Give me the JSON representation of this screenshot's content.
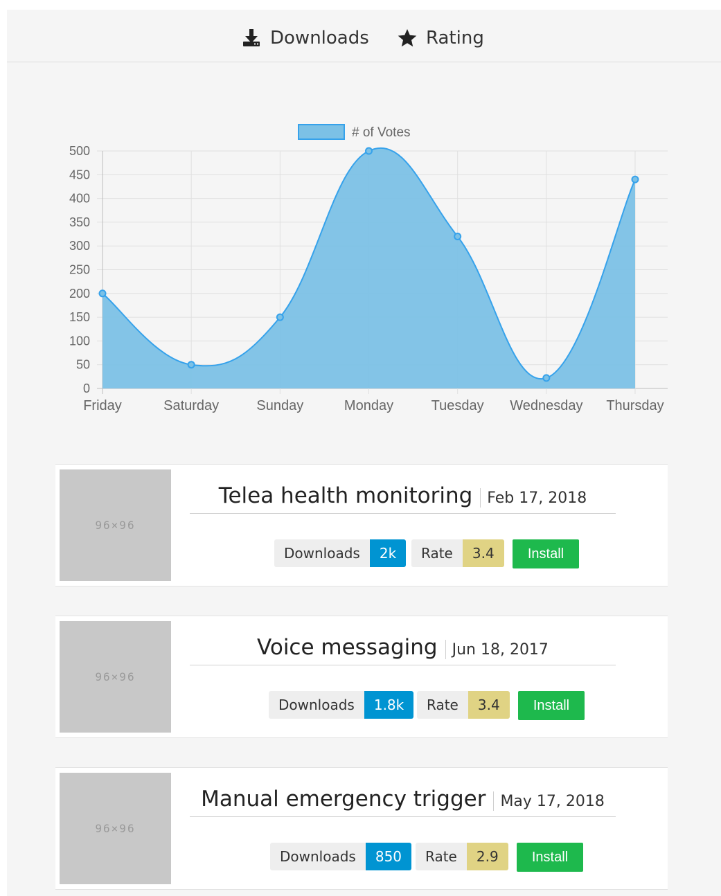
{
  "tabs": [
    {
      "label": "Downloads",
      "icon": "download-icon"
    },
    {
      "label": "Rating",
      "icon": "star-icon"
    }
  ],
  "chart_data": {
    "type": "line",
    "fill": "area",
    "categories": [
      "Friday",
      "Saturday",
      "Sunday",
      "Monday",
      "Tuesday",
      "Wednesday",
      "Thursday"
    ],
    "series": [
      {
        "name": "# of Votes",
        "values": [
          200,
          50,
          150,
          500,
          320,
          22,
          440
        ],
        "color": "#36a2eb",
        "fill_color": "#7cc1e6"
      }
    ],
    "ylim": [
      0,
      500
    ],
    "yticks": [
      0,
      50,
      100,
      150,
      200,
      250,
      300,
      350,
      400,
      450,
      500
    ],
    "grid": true,
    "legend": "top",
    "smooth": true
  },
  "apps": [
    {
      "thumb": "96×96",
      "title": "Telea health monitoring",
      "date": "Feb 17, 2018",
      "downloads_label": "Downloads",
      "downloads": "2k",
      "rate_label": "Rate",
      "rate": "3.4",
      "install": "Install"
    },
    {
      "thumb": "96×96",
      "title": "Voice messaging",
      "date": "Jun 18, 2017",
      "downloads_label": "Downloads",
      "downloads": "1.8k",
      "rate_label": "Rate",
      "rate": "3.4",
      "install": "Install"
    },
    {
      "thumb": "96×96",
      "title": "Manual emergency trigger",
      "date": "May 17, 2018",
      "downloads_label": "Downloads",
      "downloads": "850",
      "rate_label": "Rate",
      "rate": "2.9",
      "install": "Install"
    }
  ],
  "colors": {
    "downloads_badge": "#0094d2",
    "rate_badge": "#e0d384",
    "install_button": "#1eb94d"
  }
}
